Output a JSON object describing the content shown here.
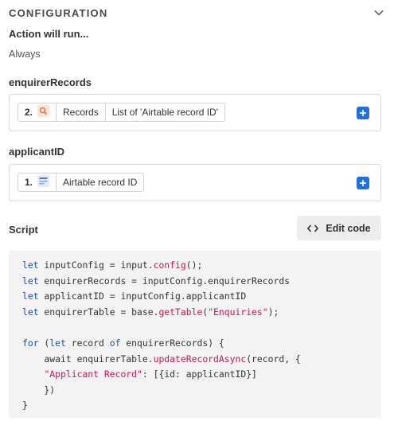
{
  "header": {
    "title": "CONFIGURATION"
  },
  "action": {
    "label": "Action will run...",
    "value": "Always"
  },
  "enquirer": {
    "label": "enquirerRecords",
    "step": "2.",
    "segments": [
      "Records",
      "List of 'Airtable record ID'"
    ]
  },
  "applicant": {
    "label": "applicantID",
    "step": "1.",
    "segments": [
      "Airtable record ID"
    ]
  },
  "script": {
    "label": "Script",
    "edit_label": "Edit code",
    "code": {
      "l1_a": "let",
      "l1_b": " inputConfig = input.",
      "l1_c": "config",
      "l1_d": "();",
      "l2_a": "let",
      "l2_b": " enquirerRecords = inputConfig.enquirerRecords",
      "l3_a": "let",
      "l3_b": " applicantID = inputConfig.applicantID",
      "l4_a": "let",
      "l4_b": " enquirerTable = base.",
      "l4_c": "getTable",
      "l4_d": "(",
      "l4_e": "\"Enquiries\"",
      "l4_f": ");",
      "l6_a": "for",
      "l6_b": " (",
      "l6_c": "let",
      "l6_d": " record ",
      "l6_e": "of",
      "l6_f": " enquirerRecords) {",
      "l7_a": "    await enquirerTable.",
      "l7_b": "updateRecordAsync",
      "l7_c": "(record, {",
      "l8_a": "    ",
      "l8_b": "\"Applicant Record\"",
      "l8_c": ": [{id: applicantID}]",
      "l9_a": "    })",
      "l10_a": "}"
    }
  },
  "colors": {
    "accent": "#1f6fe0",
    "keyword": "#1d4f9a",
    "string": "#c2185b",
    "code_bg": "#f3f3f3"
  }
}
